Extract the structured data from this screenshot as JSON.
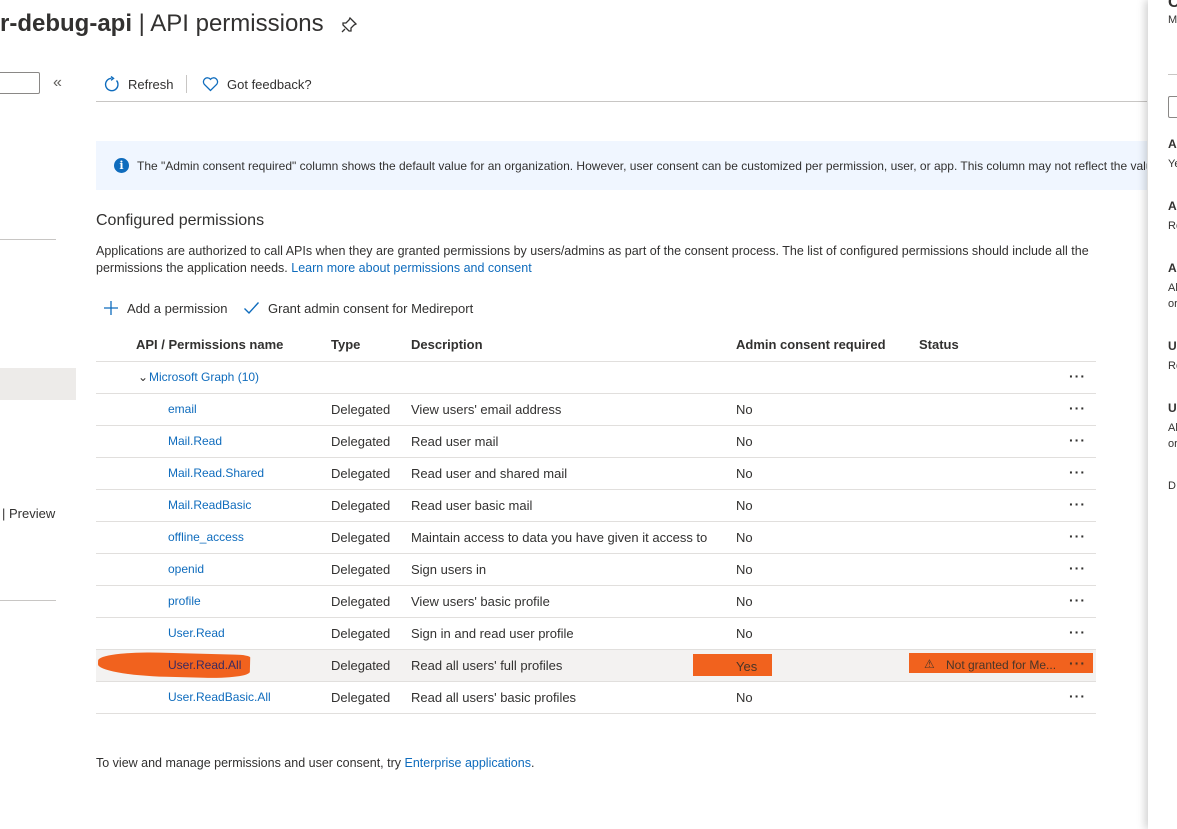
{
  "header": {
    "title_bold": "r-debug-api",
    "title_rest": " | API permissions"
  },
  "nav": {
    "preview_label": "| Preview"
  },
  "toolbar": {
    "refresh_label": "Refresh",
    "feedback_label": "Got feedback?"
  },
  "info_bar": {
    "text": "The \"Admin consent required\" column shows the default value for an organization. However, user consent can be customized per permission, user, or app. This column may not reflect the valu"
  },
  "configured": {
    "title": "Configured permissions",
    "description": "Applications are authorized to call APIs when they are granted permissions by users/admins as part of the consent process. The list of configured permissions should include all the permissions the application needs.",
    "learn_more": "Learn more about permissions and consent",
    "add_permission": "Add a permission",
    "grant_consent": "Grant admin consent for Medireport"
  },
  "table": {
    "headers": {
      "name": "API / Permissions name",
      "type": "Type",
      "description": "Description",
      "admin": "Admin consent required",
      "status": "Status"
    },
    "group": "Microsoft Graph (10)",
    "more": "···",
    "rows": [
      {
        "name": "email",
        "type": "Delegated",
        "description": "View users' email address",
        "admin": "No",
        "status": ""
      },
      {
        "name": "Mail.Read",
        "type": "Delegated",
        "description": "Read user mail",
        "admin": "No",
        "status": ""
      },
      {
        "name": "Mail.Read.Shared",
        "type": "Delegated",
        "description": "Read user and shared mail",
        "admin": "No",
        "status": ""
      },
      {
        "name": "Mail.ReadBasic",
        "type": "Delegated",
        "description": "Read user basic mail",
        "admin": "No",
        "status": ""
      },
      {
        "name": "offline_access",
        "type": "Delegated",
        "description": "Maintain access to data you have given it access to",
        "admin": "No",
        "status": ""
      },
      {
        "name": "openid",
        "type": "Delegated",
        "description": "Sign users in",
        "admin": "No",
        "status": ""
      },
      {
        "name": "profile",
        "type": "Delegated",
        "description": "View users' basic profile",
        "admin": "No",
        "status": ""
      },
      {
        "name": "User.Read",
        "type": "Delegated",
        "description": "Sign in and read user profile",
        "admin": "No",
        "status": ""
      },
      {
        "name": "User.Read.All",
        "type": "Delegated",
        "description": "Read all users' full profiles",
        "admin": "Yes",
        "status": "Not granted for Me..."
      },
      {
        "name": "User.ReadBasic.All",
        "type": "Delegated",
        "description": "Read all users' basic profiles",
        "admin": "No",
        "status": ""
      }
    ]
  },
  "footer": {
    "text": "To view and manage permissions and user consent, try ",
    "link": "Enterprise applications",
    "end": "."
  },
  "side_panel": {
    "letters": [
      "C",
      "M",
      "A",
      "Ye",
      "A",
      "Re",
      "A",
      "Al",
      "or",
      "U",
      "Re",
      "U",
      "Al",
      "or",
      "D"
    ]
  },
  "colors": {
    "link": "#0f6cbd",
    "info_bg": "#f0f6ff",
    "highlight_mark": "#f05a12"
  }
}
